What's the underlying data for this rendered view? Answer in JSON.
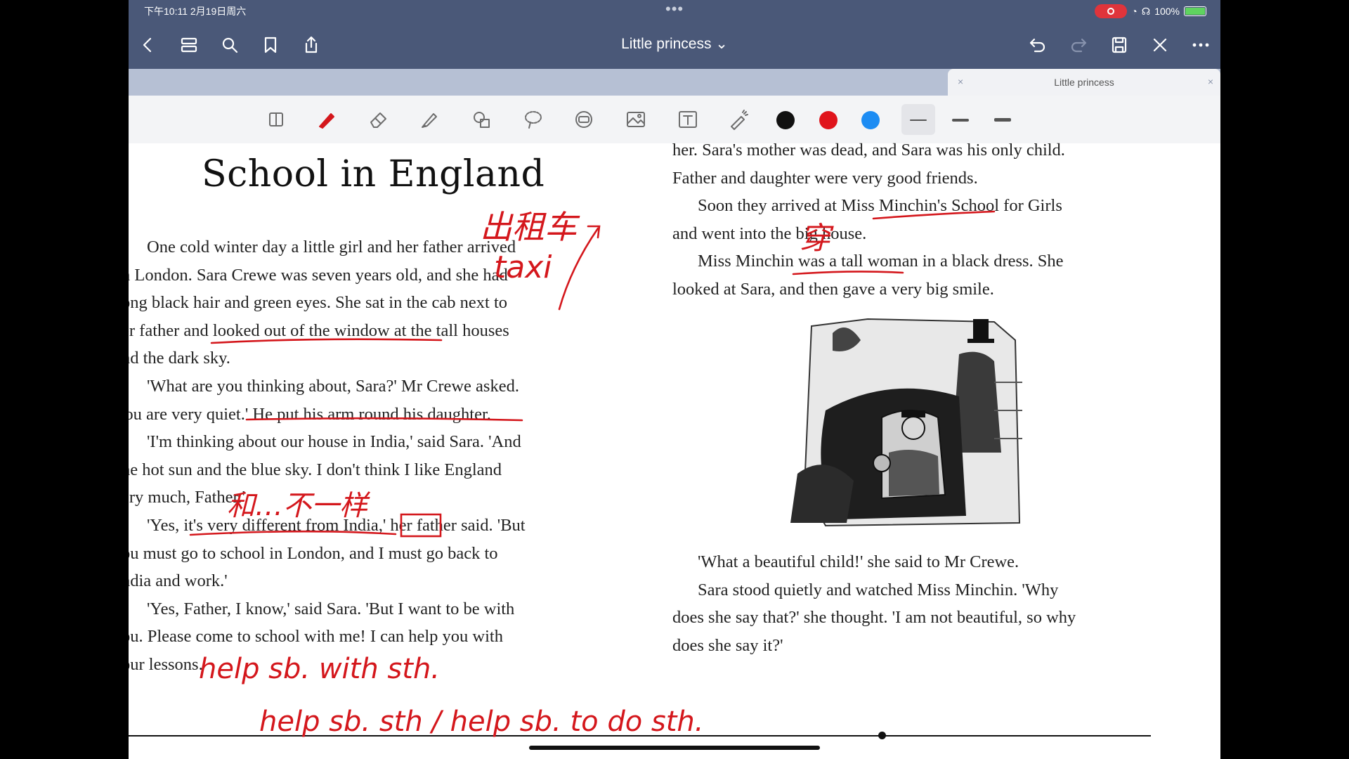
{
  "status": {
    "time": "下午10:11  2月19日周六",
    "dots": "•••",
    "battery": "100%",
    "battery_level": 1.0
  },
  "nav": {
    "title": "Little princess ⌄",
    "back_icon": "chevron-left-icon",
    "grid_icon": "thumbnails-icon",
    "search_icon": "search-icon",
    "bookmark_icon": "bookmark-icon",
    "share_icon": "share-icon",
    "undo_icon": "undo-icon",
    "redo_icon": "redo-icon",
    "save_icon": "save-icon",
    "close_icon": "close-icon",
    "more_icon": "more-icon"
  },
  "tabs": [
    {
      "label": "Little princess",
      "active": true,
      "close": "×",
      "close_right": "×"
    }
  ],
  "toolbar": {
    "colors": [
      "#111111",
      "#e0141b",
      "#1c8cf3"
    ]
  },
  "page": {
    "chapter_title": "School in England",
    "left_paragraphs": [
      "One cold winter day a little girl and her father arrived",
      "n London. Sara Crewe was seven years old, and she had",
      "ong black hair and green eyes. She sat in the cab next to",
      "er father and looked out of the window at the tall houses",
      "nd the dark sky.",
      "'What are you thinking about, Sara?' Mr Crewe asked.",
      "'ou are very quiet.' He put his arm round his daughter.",
      "'I'm thinking about our house in India,' said Sara. 'And",
      "he hot sun and the blue sky. I don't think I like England",
      "ery much, Father.'",
      "'Yes, it's very different from India,' her father said. 'But",
      "ou must go to school in London, and I must go back to",
      "ndia and work.'",
      "'Yes, Father, I know,' said Sara. 'But I want to be with",
      "ou. Please come to school with me! I can help you with",
      "our lessons.'"
    ],
    "right_paragraphs": [
      "her. Sara's mother was dead, and Sara was his only child.",
      "Father and daughter were very good friends.",
      "Soon they arrived at Miss Minchin's School for Girls",
      "and went into the big house.",
      "Miss Minchin was a tall woman in a black dress. She",
      "looked at Sara, and then gave a very big smile."
    ],
    "caption_paragraphs": [
      "'What a beautiful child!' she said to Mr Crewe.",
      "Sara stood quietly and watched Miss Minchin. 'Why",
      "does she say that?' she thought. 'I am not beautiful, so why",
      "does she say it?'"
    ]
  },
  "annotations": {
    "taxi_cn": "出租车",
    "taxi_en": "taxi",
    "dress_cn": "穿",
    "different_cn": "和…不一样",
    "help1": "help sb. with sth.",
    "help2": "help sb. sth / help sb. to do sth."
  }
}
